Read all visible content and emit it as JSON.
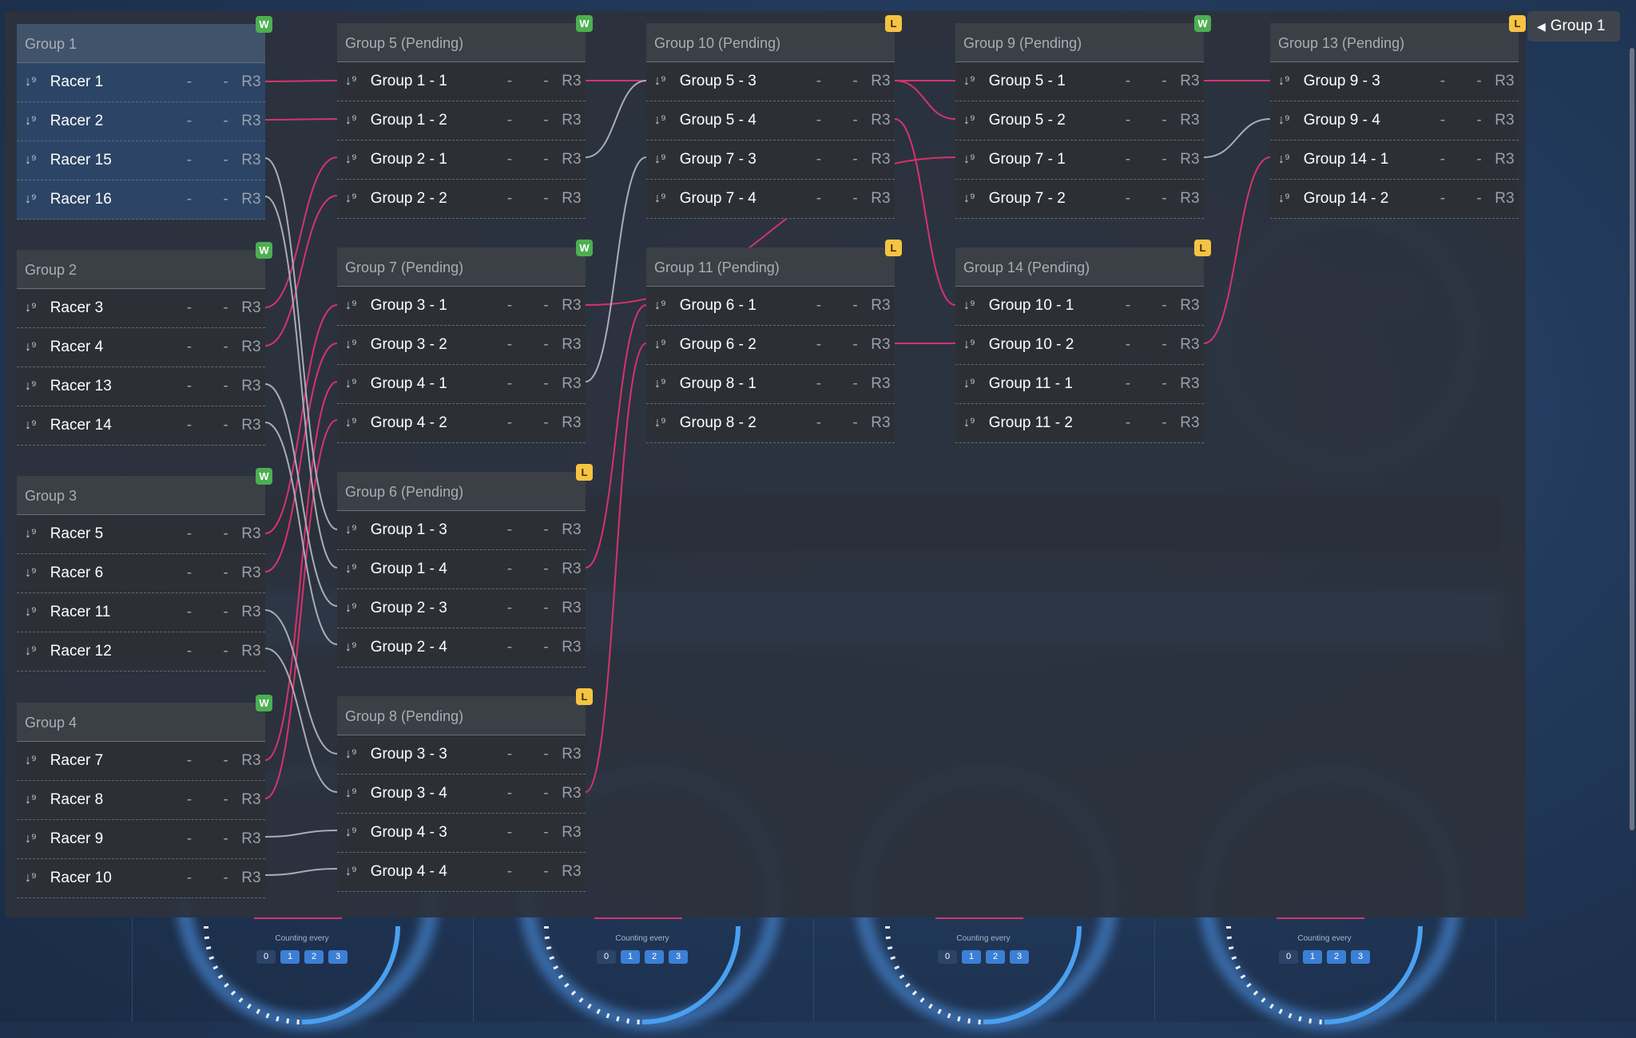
{
  "tab": {
    "label": "Group 1"
  },
  "groups": [
    {
      "key": "g1",
      "title": "Group 1",
      "badge": "W",
      "current": true,
      "rows": [
        "Racer 1",
        "Racer 2",
        "Racer 15",
        "Racer 16"
      ]
    },
    {
      "key": "g2",
      "title": "Group 2",
      "badge": "W",
      "rows": [
        "Racer 3",
        "Racer 4",
        "Racer 13",
        "Racer 14"
      ]
    },
    {
      "key": "g3",
      "title": "Group 3",
      "badge": "W",
      "rows": [
        "Racer 5",
        "Racer 6",
        "Racer 11",
        "Racer 12"
      ]
    },
    {
      "key": "g4",
      "title": "Group 4",
      "badge": "W",
      "rows": [
        "Racer 7",
        "Racer 8",
        "Racer 9",
        "Racer 10"
      ]
    },
    {
      "key": "g5",
      "title": "Group 5 (Pending)",
      "badge": "W",
      "rows": [
        "Group 1 - 1",
        "Group 1 - 2",
        "Group 2 - 1",
        "Group 2 - 2"
      ]
    },
    {
      "key": "g7",
      "title": "Group 7 (Pending)",
      "badge": "W",
      "rows": [
        "Group 3 - 1",
        "Group 3 - 2",
        "Group 4 - 1",
        "Group 4 - 2"
      ]
    },
    {
      "key": "g6",
      "title": "Group 6 (Pending)",
      "badge": "L",
      "rows": [
        "Group 1 - 3",
        "Group 1 - 4",
        "Group 2 - 3",
        "Group 2 - 4"
      ]
    },
    {
      "key": "g8",
      "title": "Group 8 (Pending)",
      "badge": "L",
      "rows": [
        "Group 3 - 3",
        "Group 3 - 4",
        "Group 4 - 3",
        "Group 4 - 4"
      ]
    },
    {
      "key": "g10",
      "title": "Group 10 (Pending)",
      "badge": "L",
      "rows": [
        "Group 5 - 3",
        "Group 5 - 4",
        "Group 7 - 3",
        "Group 7 - 4"
      ]
    },
    {
      "key": "g11",
      "title": "Group 11 (Pending)",
      "badge": "L",
      "rows": [
        "Group 6 - 1",
        "Group 6 - 2",
        "Group 8 - 1",
        "Group 8 - 2"
      ]
    },
    {
      "key": "g9",
      "title": "Group 9 (Pending)",
      "badge": "W",
      "rows": [
        "Group 5 - 1",
        "Group 5 - 2",
        "Group 7 - 1",
        "Group 7 - 2"
      ]
    },
    {
      "key": "g14",
      "title": "Group 14 (Pending)",
      "badge": "L",
      "rows": [
        "Group 10 - 1",
        "Group 10 - 2",
        "Group 11 - 1",
        "Group 11 - 2"
      ]
    },
    {
      "key": "g13",
      "title": "Group 13 (Pending)",
      "badge": "L",
      "rows": [
        "Group 9 - 3",
        "Group 9 - 4",
        "Group 14 - 1",
        "Group 14 - 2"
      ]
    }
  ],
  "row_cells": {
    "dash1": "-",
    "dash2": "-",
    "round": "R3",
    "sort_icon": "sort-numeric-icon"
  },
  "gauges": [
    {
      "label": "Counting every",
      "chips": [
        "0",
        "1",
        "2",
        "3"
      ]
    },
    {
      "label": "Counting every",
      "chips": [
        "0",
        "1",
        "2",
        "3"
      ]
    },
    {
      "label": "Counting every",
      "chips": [
        "0",
        "1",
        "2",
        "3"
      ]
    },
    {
      "label": "Counting every",
      "chips": [
        "0",
        "1",
        "2",
        "3"
      ]
    }
  ],
  "colors": {
    "win_line": "#d6336c",
    "other_line": "#a8adb5",
    "win_badge": "#4caf50",
    "loss_badge": "#f6c343"
  }
}
